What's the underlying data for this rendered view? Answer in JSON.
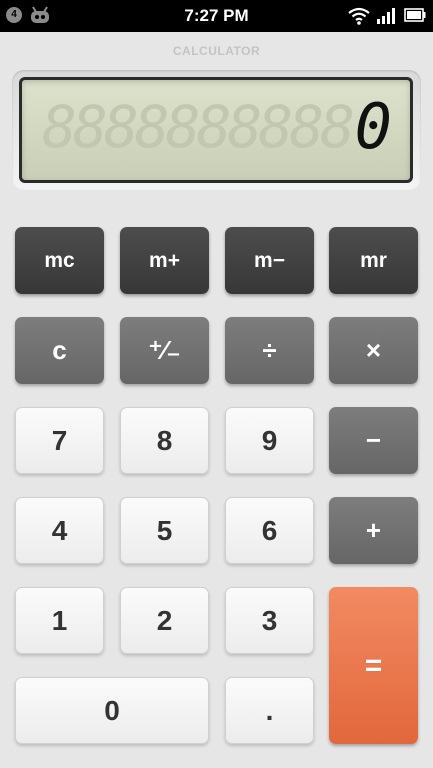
{
  "status_bar": {
    "notification_count": "4",
    "time": "7:27 PM",
    "icons": [
      "notification-badge-icon",
      "android-icon",
      "wifi-icon",
      "signal-icon",
      "battery-icon"
    ]
  },
  "app": {
    "title": "CALCULATOR"
  },
  "display": {
    "ghost_digits": "8888888888",
    "value": "0"
  },
  "keys": {
    "mc": "mc",
    "m_plus": "m+",
    "m_minus": "m−",
    "mr": "mr",
    "clear": "c",
    "plus_minus": "⁺⁄₋",
    "divide": "÷",
    "multiply": "×",
    "seven": "7",
    "eight": "8",
    "nine": "9",
    "minus": "−",
    "four": "4",
    "five": "5",
    "six": "6",
    "plus": "+",
    "one": "1",
    "two": "2",
    "three": "3",
    "equals": "=",
    "zero": "0",
    "decimal": "."
  },
  "colors": {
    "background": "#e6e6e6",
    "memory_key": "#404040",
    "operator_key": "#6e6e6e",
    "number_key": "#f3f3f3",
    "equals_key": "#e8714a",
    "lcd": "#d3d8c1"
  }
}
